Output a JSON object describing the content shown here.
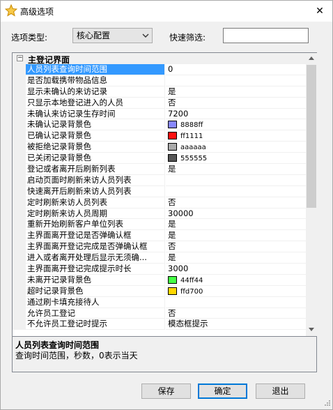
{
  "window": {
    "title": "高级选项",
    "close_glyph": "✕"
  },
  "toolbar": {
    "type_label": "选项类型:",
    "type_selected": "核心配置",
    "filter_label": "快速筛选:",
    "filter_value": ""
  },
  "grid": {
    "category_toggle": "−",
    "category_title": "主登记界面",
    "rows": [
      {
        "name": "人员列表查询时间范围",
        "value": "0",
        "selected": true
      },
      {
        "name": "是否加载携带物品信息",
        "value": ""
      },
      {
        "name": "显示未确认的来访记录",
        "value": "是"
      },
      {
        "name": "只显示本地登记进入的人员",
        "value": "否"
      },
      {
        "name": "未确认来访记录生存时间",
        "value": "7200"
      },
      {
        "name": "未确认记录背景色",
        "value": "8888ff",
        "color": "#8888ff"
      },
      {
        "name": "已确认记录背景色",
        "value": "ff1111",
        "color": "#ff1111"
      },
      {
        "name": "被拒绝记录背景色",
        "value": "aaaaaa",
        "color": "#aaaaaa"
      },
      {
        "name": "已关闭记录背景色",
        "value": "555555",
        "color": "#555555"
      },
      {
        "name": "登记或者离开后刷新列表",
        "value": "是"
      },
      {
        "name": "启动页面时刷新来访人员列表",
        "value": ""
      },
      {
        "name": "快速离开后刷新来访人员列表",
        "value": ""
      },
      {
        "name": "定时刷新来访人员列表",
        "value": "否"
      },
      {
        "name": "定时刷新来访人员周期",
        "value": "30000"
      },
      {
        "name": "重新开始刷新客户单位列表",
        "value": "是"
      },
      {
        "name": "主界面离开登记是否弹确认框",
        "value": "是"
      },
      {
        "name": "主界面离开登记完成是否弹确认框",
        "value": "否"
      },
      {
        "name": "进入或者离开处理后显示无须确...",
        "value": "是"
      },
      {
        "name": "主界面离开登记完成提示时长",
        "value": "3000"
      },
      {
        "name": "未离开记录背景色",
        "value": "44ff44",
        "color": "#44ff44"
      },
      {
        "name": "超时记录背景色",
        "value": "ffd700",
        "color": "#ffd700"
      },
      {
        "name": "通过刷卡填充接待人",
        "value": ""
      },
      {
        "name": "允许员工登记",
        "value": "否"
      },
      {
        "name": "不允许员工登记时提示",
        "value": "模态框提示"
      }
    ]
  },
  "description": {
    "title": "人员列表查询时间范围",
    "text": "查询时间范围，秒数，0表示当天"
  },
  "buttons": {
    "save": "保存",
    "ok": "确定",
    "exit": "退出"
  },
  "colors": {
    "selection": "#3399ff",
    "accent": "#0078d7"
  }
}
